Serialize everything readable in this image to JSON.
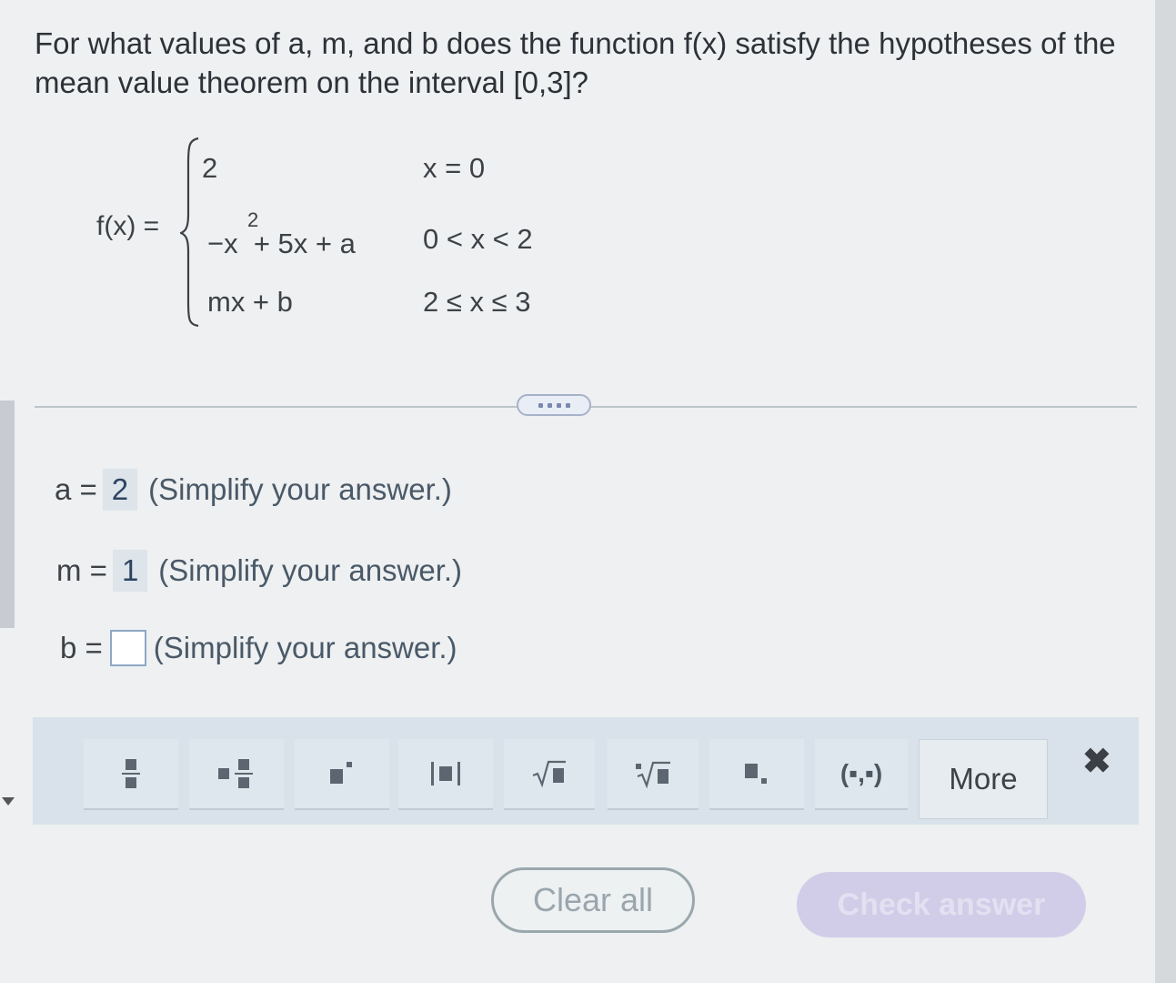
{
  "question": "For what values of a, m, and b does the function f(x) satisfy the hypotheses of the mean value theorem on the interval [0,3]?",
  "function": {
    "label": "f(x) =",
    "pieces": [
      {
        "expr": "2",
        "cond": "x = 0"
      },
      {
        "expr": "−x  + 5x + a",
        "exponent": "2",
        "cond": "0 < x < 2"
      },
      {
        "expr": "mx + b",
        "cond": "2 ≤ x ≤ 3"
      }
    ]
  },
  "answers": [
    {
      "var": "a =",
      "value": "2",
      "hint": "(Simplify your answer.)"
    },
    {
      "var": "m =",
      "value": "1",
      "hint": "(Simplify your answer.)"
    },
    {
      "var": "b =",
      "value": "",
      "hint": "(Simplify your answer.)"
    }
  ],
  "palette": {
    "buttons": [
      "fraction-icon",
      "mixed-number-icon",
      "exponent-icon",
      "absolute-value-icon",
      "square-root-icon",
      "nth-root-icon",
      "subscript-icon",
      "ordered-pair-icon"
    ],
    "ordered_pair_label": "(▪,▪)",
    "more_label": "More"
  },
  "actions": {
    "clear": "Clear all",
    "check": "Check answer"
  },
  "colors": {
    "accent": "#8fa7c4",
    "check_button": "#d1cde8"
  }
}
